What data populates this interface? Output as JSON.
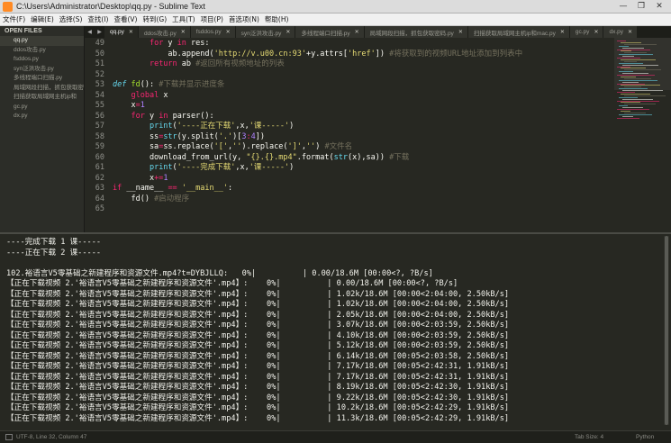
{
  "window": {
    "title": "C:\\Users\\Administrator\\Desktop\\qq.py - Sublime Text",
    "controls": [
      "—",
      "❐",
      "✕"
    ]
  },
  "menu": [
    "文件(F)",
    "编辑(E)",
    "选择(S)",
    "查找(I)",
    "查看(V)",
    "转到(G)",
    "工具(T)",
    "项目(P)",
    "首选项(N)",
    "帮助(H)"
  ],
  "sidebar": {
    "header": "OPEN FILES",
    "files": [
      "qq.py",
      "ddos攻击.py",
      "fsddos.py",
      "syn泛洪攻击.py",
      "多线程端口扫描.py",
      "局域网段扫描，抓包获取密码",
      "扫描获取局域网主机ip和",
      "gc.py",
      "dx.py"
    ]
  },
  "tabs": {
    "arrows": [
      "◀",
      "▶"
    ],
    "close": "✕",
    "items": [
      "qq.py",
      "ddos攻击.py",
      "fsddos.py",
      "syn泛洪攻击.py",
      "多线程端口扫描.py",
      "局域网段扫描，抓包获取密码.py",
      "扫描获取局域网主机ip和mac.py",
      "gc.py",
      "dx.py"
    ]
  },
  "editor": {
    "lines": [
      {
        "n": "49",
        "tokens": [
          [
            "        ",
            ""
          ],
          [
            "for",
            "kw"
          ],
          [
            " y ",
            ""
          ],
          [
            "in",
            "kw"
          ],
          [
            " res:",
            ""
          ]
        ]
      },
      {
        "n": "50",
        "tokens": [
          [
            "            ab.append(",
            ""
          ],
          [
            "'http://v.u00.cn:93'",
            "st"
          ],
          [
            "+y.attrs[",
            ""
          ],
          [
            "'href'",
            "st"
          ],
          [
            "]) ",
            ""
          ],
          [
            "#将获取到的视频URL地址添加到列表中",
            "cm"
          ]
        ]
      },
      {
        "n": "51",
        "tokens": [
          [
            "        ",
            ""
          ],
          [
            "return",
            "kw"
          ],
          [
            " ab ",
            ""
          ],
          [
            "#返回所有视频地址的列表",
            "cm"
          ]
        ]
      },
      {
        "n": "52",
        "tokens": [
          [
            "",
            ""
          ]
        ]
      },
      {
        "n": "53",
        "tokens": [
          [
            "def",
            "it"
          ],
          [
            " ",
            ""
          ],
          [
            "fd",
            "fn"
          ],
          [
            "(): ",
            ""
          ],
          [
            "#下载并显示进度条",
            "cm"
          ]
        ]
      },
      {
        "n": "54",
        "tokens": [
          [
            "    ",
            ""
          ],
          [
            "global",
            "kw"
          ],
          [
            " x",
            ""
          ]
        ]
      },
      {
        "n": "55",
        "tokens": [
          [
            "    x",
            ""
          ],
          [
            "=",
            "kw"
          ],
          [
            "1",
            "nu"
          ]
        ]
      },
      {
        "n": "56",
        "tokens": [
          [
            "    ",
            ""
          ],
          [
            "for",
            "kw"
          ],
          [
            " y ",
            ""
          ],
          [
            "in",
            "kw"
          ],
          [
            " parser():",
            ""
          ]
        ]
      },
      {
        "n": "57",
        "tokens": [
          [
            "        ",
            ""
          ],
          [
            "print",
            "bi"
          ],
          [
            "(",
            ""
          ],
          [
            "'----正在下载'",
            "st"
          ],
          [
            ",x,",
            ""
          ],
          [
            "'课-----'",
            "st"
          ],
          [
            ")",
            ""
          ]
        ]
      },
      {
        "n": "58",
        "tokens": [
          [
            "        ss",
            ""
          ],
          [
            "=",
            "kw"
          ],
          [
            "str",
            "bi"
          ],
          [
            "(y.split(",
            ""
          ],
          [
            "'.'",
            "st"
          ],
          [
            ")[",
            ""
          ],
          [
            "3",
            "nu"
          ],
          [
            ":",
            "kw"
          ],
          [
            "4",
            "nu"
          ],
          [
            "])",
            ""
          ]
        ]
      },
      {
        "n": "59",
        "tokens": [
          [
            "        sa",
            ""
          ],
          [
            "=",
            "kw"
          ],
          [
            "ss.replace(",
            ""
          ],
          [
            "'['",
            "st"
          ],
          [
            ",",
            ""
          ],
          [
            "''",
            "st"
          ],
          [
            ").replace(",
            ""
          ],
          [
            "']'",
            "st"
          ],
          [
            ",",
            ""
          ],
          [
            "''",
            "st"
          ],
          [
            ") ",
            ""
          ],
          [
            "#文件名",
            "cm"
          ]
        ]
      },
      {
        "n": "60",
        "tokens": [
          [
            "        download_from_url(y, ",
            ""
          ],
          [
            "\"{}.{}.mp4\"",
            "st"
          ],
          [
            ".format(",
            ""
          ],
          [
            "str",
            "bi"
          ],
          [
            "(x),sa)) ",
            ""
          ],
          [
            "#下载",
            "cm"
          ]
        ]
      },
      {
        "n": "61",
        "tokens": [
          [
            "        ",
            ""
          ],
          [
            "print",
            "bi"
          ],
          [
            "(",
            ""
          ],
          [
            "'----完成下载'",
            "st"
          ],
          [
            ",x,",
            ""
          ],
          [
            "'课-----'",
            "st"
          ],
          [
            ")",
            ""
          ]
        ]
      },
      {
        "n": "62",
        "tokens": [
          [
            "        x",
            ""
          ],
          [
            "+=",
            "kw"
          ],
          [
            "1",
            "nu"
          ]
        ]
      },
      {
        "n": "63",
        "tokens": [
          [
            "if",
            "kw"
          ],
          [
            " __name__ ",
            ""
          ],
          [
            "==",
            "kw"
          ],
          [
            " ",
            ""
          ],
          [
            "'__main__'",
            "st"
          ],
          [
            ":",
            ""
          ]
        ]
      },
      {
        "n": "64",
        "tokens": [
          [
            "    fd() ",
            ""
          ],
          [
            "#启动程序",
            "cm"
          ]
        ]
      },
      {
        "n": "65",
        "tokens": [
          [
            "",
            ""
          ]
        ]
      }
    ]
  },
  "output": {
    "lines": [
      "----完成下载 1 课-----",
      "----正在下载 2 课-----",
      "",
      "102.裕语言V5零基础之新建程序和资源文件.mp4?t=DYBJLLQ:   0%|          | 0.00/18.6M [00:00<?, ?B/s]",
      "【正在下载视频 2.'裕语言V5零基础之新建程序和资源文件'.mp4】:    0%|          | 0.00/18.6M [00:00<?, ?B/s]",
      "【正在下载视频 2.'裕语言V5零基础之新建程序和资源文件'.mp4】:    0%|          | 1.02k/18.6M [00:00<2:04:00, 2.50kB/s]",
      "【正在下载视频 2.'裕语言V5零基础之新建程序和资源文件'.mp4】:    0%|          | 1.02k/18.6M [00:00<2:04:00, 2.50kB/s]",
      "【正在下载视频 2.'裕语言V5零基础之新建程序和资源文件'.mp4】:    0%|          | 2.05k/18.6M [00:00<2:04:00, 2.50kB/s]",
      "【正在下载视频 2.'裕语言V5零基础之新建程序和资源文件'.mp4】:    0%|          | 3.07k/18.6M [00:00<2:03:59, 2.50kB/s]",
      "【正在下载视频 2.'裕语言V5零基础之新建程序和资源文件'.mp4】:    0%|          | 4.10k/18.6M [00:00<2:03:59, 2.50kB/s]",
      "【正在下载视频 2.'裕语言V5零基础之新建程序和资源文件'.mp4】:    0%|          | 5.12k/18.6M [00:00<2:03:59, 2.50kB/s]",
      "【正在下载视频 2.'裕语言V5零基础之新建程序和资源文件'.mp4】:    0%|          | 6.14k/18.6M [00:05<2:03:58, 2.50kB/s]",
      "【正在下载视频 2.'裕语言V5零基础之新建程序和资源文件'.mp4】:    0%|          | 7.17k/18.6M [00:05<2:42:31, 1.91kB/s]",
      "【正在下载视频 2.'裕语言V5零基础之新建程序和资源文件'.mp4】:    0%|          | 7.17k/18.6M [00:05<2:42:31, 1.91kB/s]",
      "【正在下载视频 2.'裕语言V5零基础之新建程序和资源文件'.mp4】:    0%|          | 8.19k/18.6M [00:05<2:42:30, 1.91kB/s]",
      "【正在下载视频 2.'裕语言V5零基础之新建程序和资源文件'.mp4】:    0%|          | 9.22k/18.6M [00:05<2:42:30, 1.91kB/s]",
      "【正在下载视频 2.'裕语言V5零基础之新建程序和资源文件'.mp4】:    0%|          | 10.2k/18.6M [00:05<2:42:29, 1.91kB/s]",
      "【正在下载视频 2.'裕语言V5零基础之新建程序和资源文件'.mp4】:    0%|          | 11.3k/18.6M [00:05<2:42:29, 1.91kB/s]"
    ]
  },
  "status": {
    "left": "UTF-8, Line 32, Column 47",
    "tab_size": "Tab Size: 4",
    "syntax": "Python"
  },
  "colors": {
    "background": "#272822",
    "keyword": "#f92672",
    "string": "#e6db74",
    "comment": "#75715e",
    "function": "#a6e22e",
    "builtin": "#66d9ef",
    "number": "#ae81ff"
  }
}
